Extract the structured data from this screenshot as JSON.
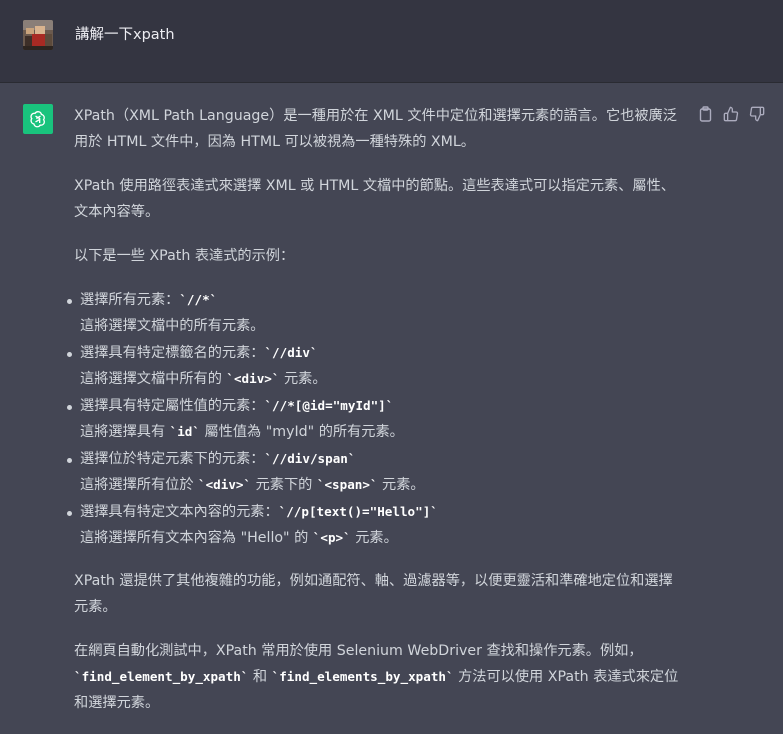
{
  "user": {
    "avatar_icon": "user-avatar-photo",
    "message": "講解一下xpath"
  },
  "assistant": {
    "logo_icon": "openai-logo-icon",
    "actions": [
      "copy-icon",
      "thumbs-up-icon",
      "thumbs-down-icon"
    ],
    "p1": "XPath（XML Path Language）是一種用於在 XML 文件中定位和選擇元素的語言。它也被廣泛用於 HTML 文件中，因為 HTML 可以被視為一種特殊的 XML。",
    "p2": "XPath 使用路徑表達式來選擇 XML 或 HTML 文檔中的節點。這些表達式可以指定元素、屬性、文本內容等。",
    "p3": "以下是一些 XPath 表達式的示例：",
    "examples": [
      {
        "title": "選擇所有元素：",
        "expr": "`//*`",
        "desc_pre": "這將選擇文檔中的所有元素。",
        "desc_code": "",
        "desc_post": "",
        "desc_code2": "",
        "desc_post2": ""
      },
      {
        "title": "選擇具有特定標籤名的元素：",
        "expr": "`//div`",
        "desc_pre": "這將選擇文檔中所有的 ",
        "desc_code": "`<div>`",
        "desc_post": " 元素。",
        "desc_code2": "",
        "desc_post2": ""
      },
      {
        "title": "選擇具有特定屬性值的元素：",
        "expr": "`//*[@id=\"myId\"]`",
        "desc_pre": "這將選擇具有 ",
        "desc_code": "`id`",
        "desc_post": " 屬性值為 \"myId\" 的所有元素。",
        "desc_code2": "",
        "desc_post2": ""
      },
      {
        "title": "選擇位於特定元素下的元素：",
        "expr": "`//div/span`",
        "desc_pre": "這將選擇所有位於 ",
        "desc_code": "`<div>`",
        "desc_post": " 元素下的 ",
        "desc_code2": "`<span>`",
        "desc_post2": " 元素。"
      },
      {
        "title": "選擇具有特定文本內容的元素：",
        "expr": "`//p[text()=\"Hello\"]`",
        "desc_pre": "這將選擇所有文本內容為 \"Hello\" 的 ",
        "desc_code": "`<p>`",
        "desc_post": " 元素。",
        "desc_code2": "",
        "desc_post2": ""
      }
    ],
    "p4": "XPath 還提供了其他複雜的功能，例如通配符、軸、過濾器等，以便更靈活和準確地定位和選擇元素。",
    "p5_pre": "在網頁自動化測試中，XPath 常用於使用 Selenium WebDriver 查找和操作元素。例如，",
    "p5_code1": "`find_element_by_xpath`",
    "p5_mid": " 和 ",
    "p5_code2": "`find_elements_by_xpath`",
    "p5_post": " 方法可以使用 XPath 表達式來定位和選擇元素。"
  }
}
